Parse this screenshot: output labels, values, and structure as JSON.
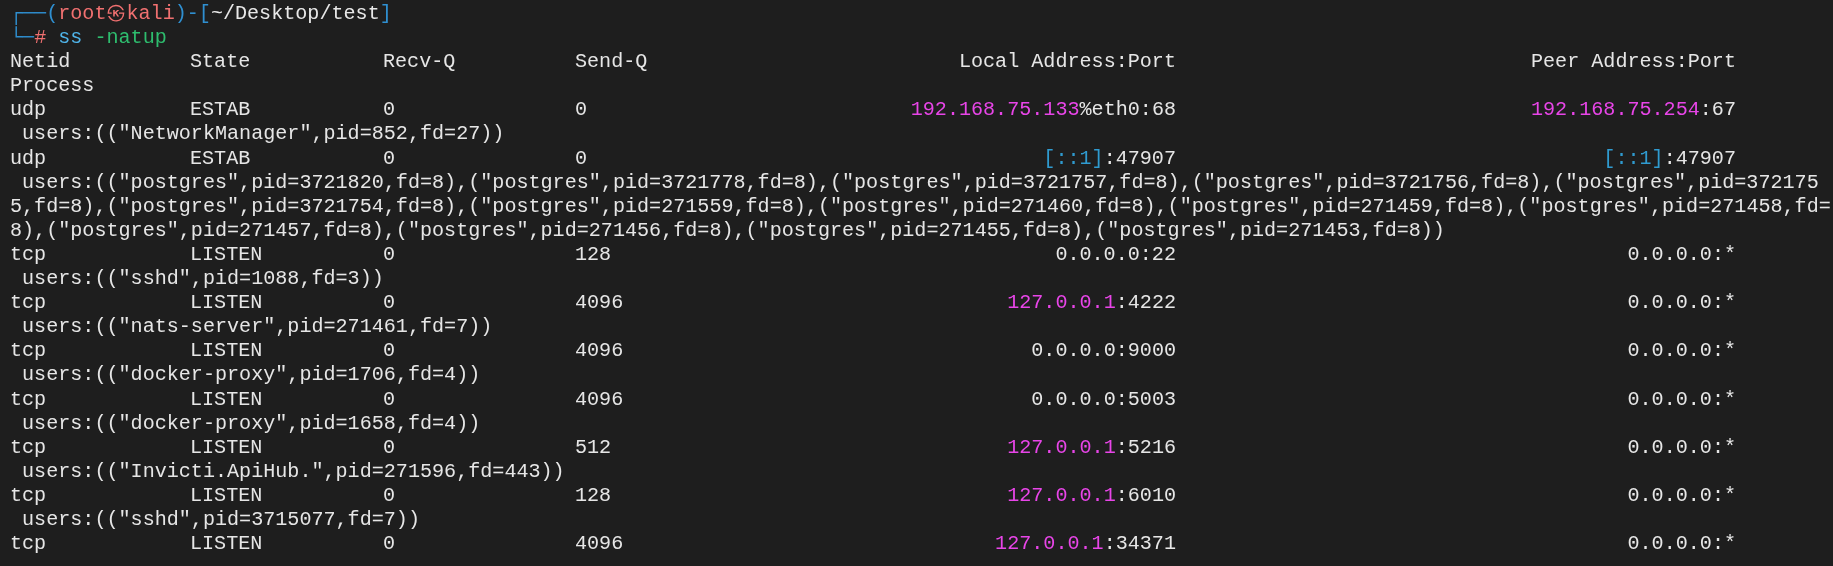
{
  "prompt": {
    "line1": [
      {
        "text": "┌──(",
        "kind": "frame"
      },
      {
        "text": "root㉿kali",
        "kind": "user"
      },
      {
        "text": ")-[",
        "kind": "frame"
      },
      {
        "text": "~/Desktop/test",
        "kind": "path"
      },
      {
        "text": "]",
        "kind": "frame"
      }
    ],
    "line2": [
      {
        "text": "└─",
        "kind": "frame"
      },
      {
        "text": "#",
        "kind": "user"
      },
      {
        "text": " ss",
        "kind": "command"
      },
      {
        "text": " -natup",
        "kind": "argument"
      }
    ]
  },
  "header": {
    "netid": "Netid",
    "state": "State",
    "recv_q": "Recv-Q",
    "send_q": "Send-Q",
    "local": "Local Address:Port",
    "peer": "Peer Address:Port",
    "process": "Process"
  },
  "rows": [
    {
      "netid": "udp",
      "state": "ESTAB",
      "recv_q": "0",
      "send_q": "0",
      "local": {
        "host": "192.168.75.133",
        "rest": "%eth0:68",
        "kind": "ipv4"
      },
      "peer": {
        "host": "192.168.75.254",
        "rest": ":67",
        "kind": "ipv4"
      },
      "process": "users:((\"NetworkManager\",pid=852,fd=27))"
    },
    {
      "netid": "udp",
      "state": "ESTAB",
      "recv_q": "0",
      "send_q": "0",
      "local": {
        "host": "[::1]",
        "rest": ":47907",
        "kind": "ipv6"
      },
      "peer": {
        "host": "[::1]",
        "rest": ":47907",
        "kind": "ipv6"
      },
      "process": "users:((\"postgres\",pid=3721820,fd=8),(\"postgres\",pid=3721778,fd=8),(\"postgres\",pid=3721757,fd=8),(\"postgres\",pid=3721756,fd=8),(\"postgres\",pid=3721755,fd=8),(\"postgres\",pid=3721754,fd=8),(\"postgres\",pid=271559,fd=8),(\"postgres\",pid=271460,fd=8),(\"postgres\",pid=271459,fd=8),(\"postgres\",pid=271458,fd=8),(\"postgres\",pid=271457,fd=8),(\"postgres\",pid=271456,fd=8),(\"postgres\",pid=271455,fd=8),(\"postgres\",pid=271453,fd=8))"
    },
    {
      "netid": "tcp",
      "state": "LISTEN",
      "recv_q": "0",
      "send_q": "128",
      "local": {
        "host": "0.0.0.0",
        "rest": ":22",
        "kind": "any"
      },
      "peer": {
        "host": "0.0.0.0",
        "rest": ":*",
        "kind": "any"
      },
      "process": "users:((\"sshd\",pid=1088,fd=3))"
    },
    {
      "netid": "tcp",
      "state": "LISTEN",
      "recv_q": "0",
      "send_q": "4096",
      "local": {
        "host": "127.0.0.1",
        "rest": ":4222",
        "kind": "ipv4"
      },
      "peer": {
        "host": "0.0.0.0",
        "rest": ":*",
        "kind": "any"
      },
      "process": "users:((\"nats-server\",pid=271461,fd=7))"
    },
    {
      "netid": "tcp",
      "state": "LISTEN",
      "recv_q": "0",
      "send_q": "4096",
      "local": {
        "host": "0.0.0.0",
        "rest": ":9000",
        "kind": "any"
      },
      "peer": {
        "host": "0.0.0.0",
        "rest": ":*",
        "kind": "any"
      },
      "process": "users:((\"docker-proxy\",pid=1706,fd=4))"
    },
    {
      "netid": "tcp",
      "state": "LISTEN",
      "recv_q": "0",
      "send_q": "4096",
      "local": {
        "host": "0.0.0.0",
        "rest": ":5003",
        "kind": "any"
      },
      "peer": {
        "host": "0.0.0.0",
        "rest": ":*",
        "kind": "any"
      },
      "process": "users:((\"docker-proxy\",pid=1658,fd=4))"
    },
    {
      "netid": "tcp",
      "state": "LISTEN",
      "recv_q": "0",
      "send_q": "512",
      "local": {
        "host": "127.0.0.1",
        "rest": ":5216",
        "kind": "ipv4"
      },
      "peer": {
        "host": "0.0.0.0",
        "rest": ":*",
        "kind": "any"
      },
      "process": "users:((\"Invicti.ApiHub.\",pid=271596,fd=443))"
    },
    {
      "netid": "tcp",
      "state": "LISTEN",
      "recv_q": "0",
      "send_q": "128",
      "local": {
        "host": "127.0.0.1",
        "rest": ":6010",
        "kind": "ipv4"
      },
      "peer": {
        "host": "0.0.0.0",
        "rest": ":*",
        "kind": "any"
      },
      "process": "users:((\"sshd\",pid=3715077,fd=7))"
    },
    {
      "netid": "tcp",
      "state": "LISTEN",
      "recv_q": "0",
      "send_q": "4096",
      "local": {
        "host": "127.0.0.1",
        "rest": ":34371",
        "kind": "ipv4"
      },
      "peer": {
        "host": "0.0.0.0",
        "rest": ":*",
        "kind": "any"
      }
    }
  ]
}
